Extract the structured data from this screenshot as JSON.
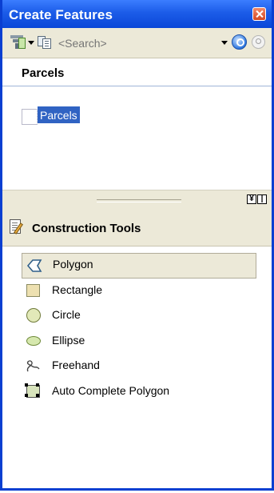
{
  "window": {
    "title": "Create Features"
  },
  "toolbar": {
    "search_placeholder": "<Search>"
  },
  "templates": {
    "layer_name": "Parcels",
    "items": [
      {
        "label": "Parcels",
        "selected": true
      }
    ]
  },
  "construction_tools": {
    "title": "Construction Tools",
    "items": [
      {
        "label": "Polygon",
        "icon": "polygon-icon",
        "selected": true
      },
      {
        "label": "Rectangle",
        "icon": "rectangle-icon",
        "selected": false
      },
      {
        "label": "Circle",
        "icon": "circle-icon",
        "selected": false
      },
      {
        "label": "Ellipse",
        "icon": "ellipse-icon",
        "selected": false
      },
      {
        "label": "Freehand",
        "icon": "freehand-icon",
        "selected": false
      },
      {
        "label": "Auto Complete Polygon",
        "icon": "auto-complete-polygon-icon",
        "selected": false
      }
    ]
  },
  "colors": {
    "title_bar": "#1c5ce8",
    "panel": "#ece9d8",
    "selection": "#3063c3",
    "close": "#d24722"
  }
}
